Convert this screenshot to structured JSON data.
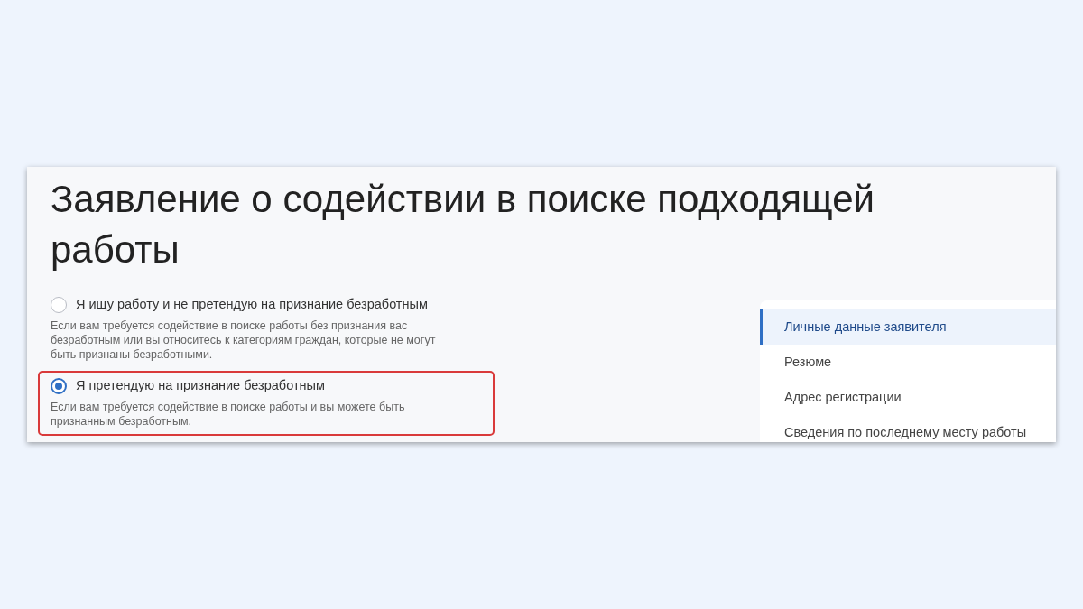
{
  "title": "Заявление о содействии в поиске подходящей работы",
  "options": [
    {
      "label": "Я ищу работу и не претендую на признание безработным",
      "description": "Если вам требуется содействие в поиске работы без признания вас безработным или вы относитесь к категориям граждан, которые не могут быть признаны безработными.",
      "selected": false,
      "highlighted": false
    },
    {
      "label": "Я претендую на признание безработным",
      "description": "Если вам требуется содействие в поиске работы и вы можете быть признанным безработным.",
      "selected": true,
      "highlighted": true
    }
  ],
  "sections": [
    {
      "label": "Личные данные заявителя",
      "selected": true
    },
    {
      "label": "Резюме",
      "selected": false
    },
    {
      "label": "Адрес регистрации",
      "selected": false
    },
    {
      "label": "Сведения по последнему месту работы",
      "selected": false
    }
  ]
}
